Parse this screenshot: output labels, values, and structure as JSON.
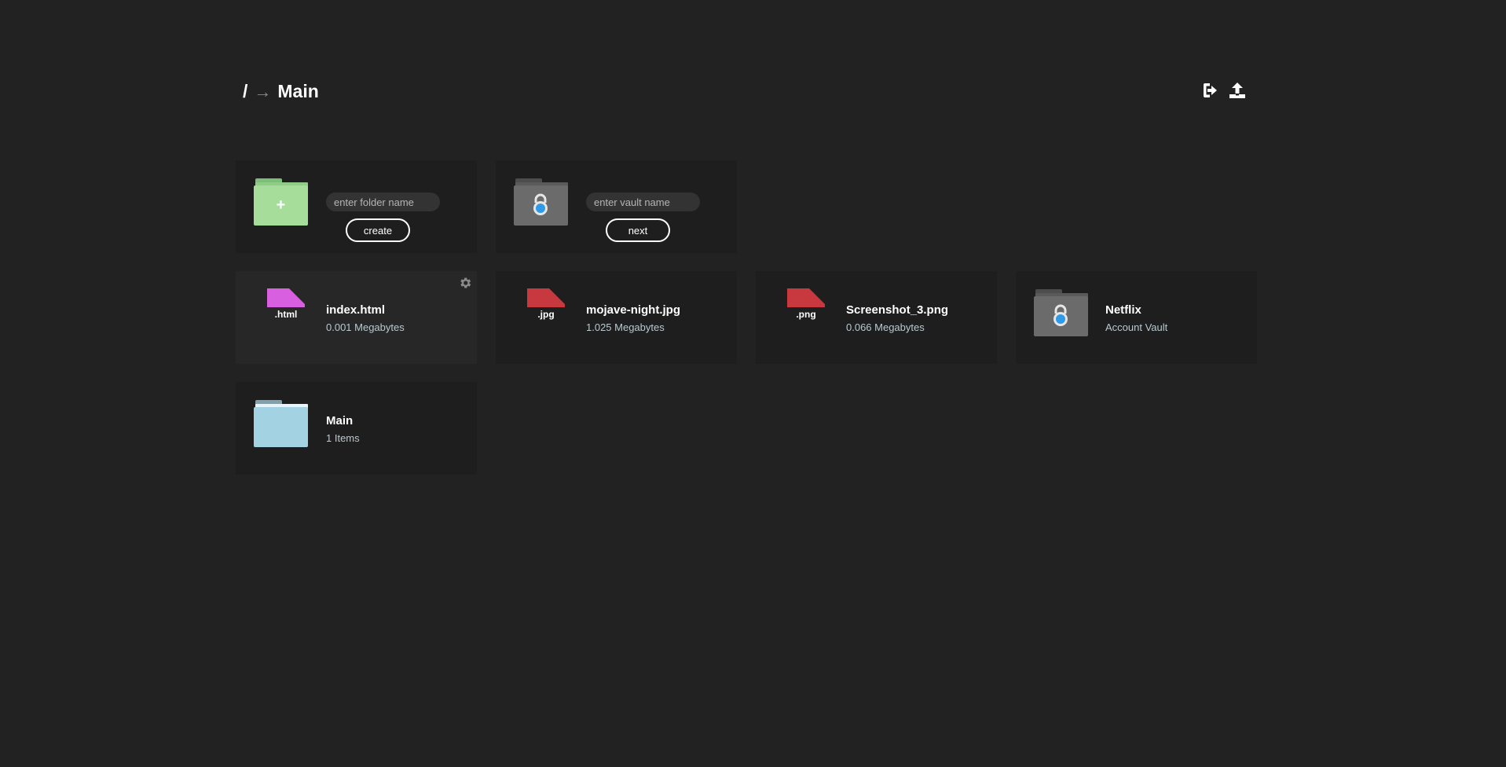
{
  "breadcrumb": {
    "root": "/",
    "separator": "→",
    "current": "Main"
  },
  "header": {
    "actions": [
      {
        "icon": "logout-icon"
      },
      {
        "icon": "upload-icon"
      }
    ]
  },
  "create_folder": {
    "placeholder": "enter folder name",
    "button_label": "create",
    "icon": "plus"
  },
  "create_vault": {
    "placeholder": "enter vault name",
    "button_label": "next"
  },
  "files": [
    {
      "name": "index.html",
      "size": "0.001 Megabytes",
      "ext": ".html",
      "color": "#d85fe0"
    },
    {
      "name": "mojave-night.jpg",
      "size": "1.025 Megabytes",
      "ext": ".jpg",
      "color": "#c8383f"
    },
    {
      "name": "Screenshot_3.png",
      "size": "0.066 Megabytes",
      "ext": ".png",
      "color": "#c8383f"
    }
  ],
  "vault": {
    "name": "Netflix",
    "subtitle": "Account Vault"
  },
  "folder": {
    "name": "Main",
    "subtitle": "1 Items"
  },
  "colors": {
    "background": "#222222",
    "card": "#1e1e1e",
    "new_folder_green": "#a6dd9b",
    "vault_gray": "#6b6b6b",
    "folder_blue": "#a3d3e3",
    "lock_blue": "#2f9be8"
  }
}
